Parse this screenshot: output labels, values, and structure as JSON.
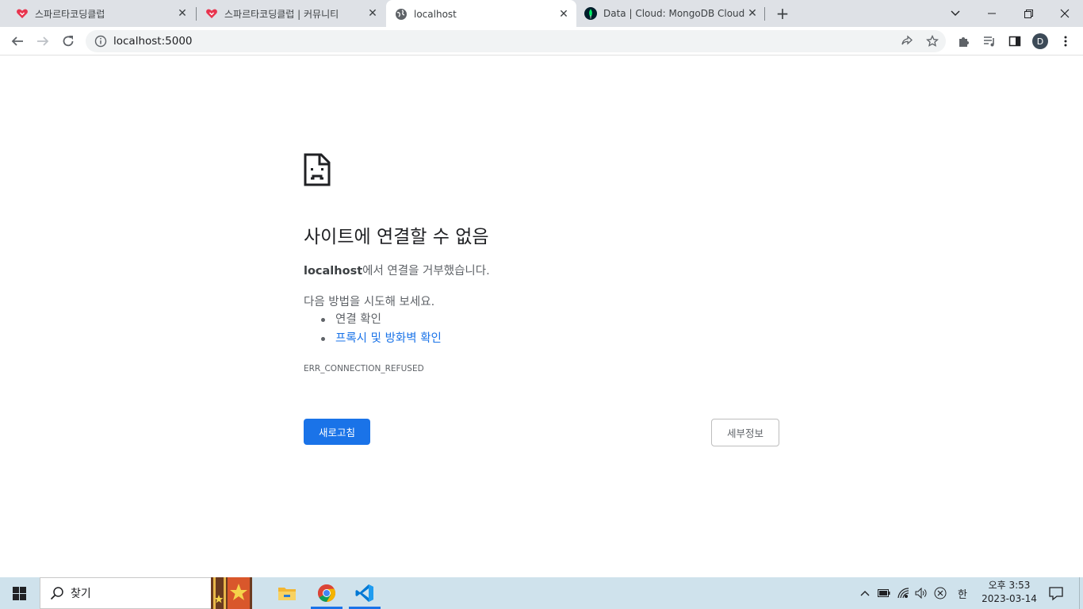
{
  "browser": {
    "tabs": [
      {
        "title": "스파르타코딩클럽",
        "icon": "sparta-heart-icon",
        "active": false
      },
      {
        "title": "스파르타코딩클럽 | 커뮤니티",
        "icon": "sparta-heart-icon",
        "active": false
      },
      {
        "title": "localhost",
        "icon": "globe-icon",
        "active": true
      },
      {
        "title": "Data | Cloud: MongoDB Cloud",
        "icon": "mongodb-leaf-icon",
        "active": false
      }
    ],
    "new_tab_symbol": "+",
    "url": "localhost:5000",
    "profile_initial": "D"
  },
  "error_page": {
    "title": "사이트에 연결할 수 없음",
    "host": "localhost",
    "host_suffix": "에서 연결을 거부했습니다.",
    "try_label": "다음 방법을 시도해 보세요.",
    "suggestions": [
      "연결 확인",
      "프록시 및 방화벽 확인"
    ],
    "error_code": "ERR_CONNECTION_REFUSED",
    "reload_label": "새로고침",
    "details_label": "세부정보"
  },
  "taskbar": {
    "search_placeholder": "찾기",
    "ime_label": "한",
    "clock_time": "오후 3:53",
    "clock_date": "2023-03-14"
  },
  "colors": {
    "accent": "#1a73e8",
    "tabstrip": "#dee1e6",
    "taskbar": "#cfe2ec"
  }
}
